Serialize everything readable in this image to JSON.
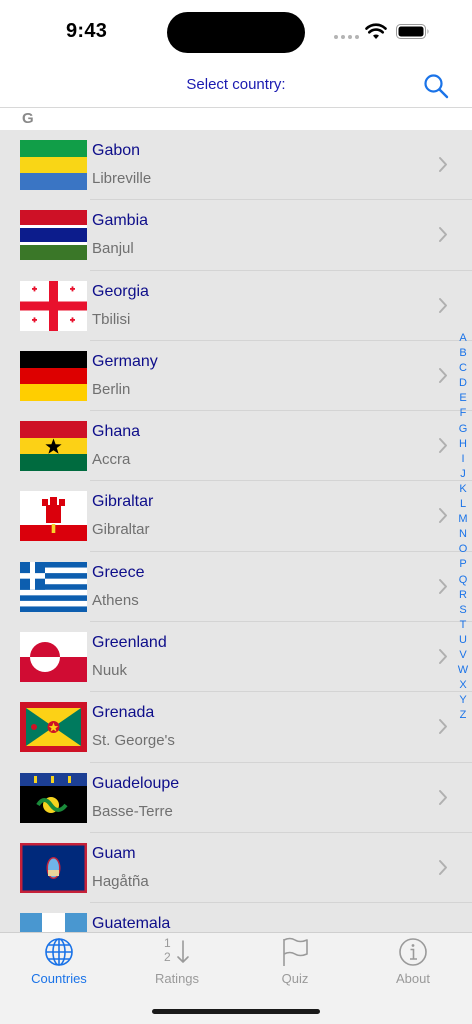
{
  "status": {
    "time": "9:43"
  },
  "nav": {
    "title": "Select country:"
  },
  "section": {
    "letter": "G"
  },
  "countries": [
    {
      "name": "Gabon",
      "capital": "Libreville"
    },
    {
      "name": "Gambia",
      "capital": "Banjul"
    },
    {
      "name": "Georgia",
      "capital": "Tbilisi"
    },
    {
      "name": "Germany",
      "capital": "Berlin"
    },
    {
      "name": "Ghana",
      "capital": "Accra"
    },
    {
      "name": "Gibraltar",
      "capital": "Gibraltar"
    },
    {
      "name": "Greece",
      "capital": "Athens"
    },
    {
      "name": "Greenland",
      "capital": "Nuuk"
    },
    {
      "name": "Grenada",
      "capital": "St. George's"
    },
    {
      "name": "Guadeloupe",
      "capital": "Basse-Terre"
    },
    {
      "name": "Guam",
      "capital": "Hagåtña"
    },
    {
      "name": "Guatemala",
      "capital": ""
    }
  ],
  "index_letters": [
    "A",
    "B",
    "C",
    "D",
    "E",
    "F",
    "G",
    "H",
    "I",
    "J",
    "K",
    "L",
    "M",
    "N",
    "O",
    "P",
    "Q",
    "R",
    "S",
    "T",
    "U",
    "V",
    "W",
    "X",
    "Y",
    "Z"
  ],
  "tabs": [
    {
      "label": "Countries",
      "icon": "globe-icon",
      "active": true
    },
    {
      "label": "Ratings",
      "icon": "sort-icon",
      "active": false
    },
    {
      "label": "Quiz",
      "icon": "flag-icon",
      "active": false
    },
    {
      "label": "About",
      "icon": "info-icon",
      "active": false
    }
  ],
  "ratings_icon_digits": [
    "1",
    "2"
  ],
  "colors": {
    "accent": "#1a73e8",
    "title": "#0e0e8a",
    "subtitle": "#707070"
  }
}
